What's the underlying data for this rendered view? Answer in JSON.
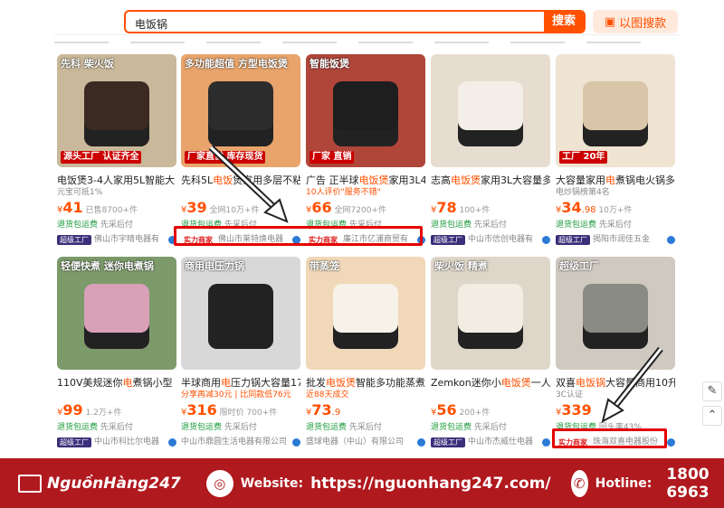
{
  "search": {
    "query": "电饭锅",
    "button": "搜索",
    "image_search": "以图搜款"
  },
  "row1": [
    {
      "title_pre": "电饭煲3-4人家用5L智能大",
      "hl": "",
      "title_post": "",
      "sub": "元宝可抵1%",
      "sub_red": false,
      "price": "41",
      "price_suffix": "",
      "sold": "已售8700+件",
      "ship": "退货包运费",
      "ship2": "先采后付",
      "badge": "超级工厂",
      "shop": "佛山市宇晴电器有",
      "ov": "先科 柴火饭",
      "ov2": "源头工厂 认证齐全",
      "bg": "#c9b89a",
      "pr": "#3a2a22"
    },
    {
      "title_pre": "先科5L",
      "hl": "电饭",
      "title_post": "煲家用多层不粘球釜",
      "sub": "",
      "sub_red": false,
      "price": "39",
      "price_suffix": "",
      "sold": "全网10万+件",
      "ship": "退货包运费",
      "ship2": "先采后付",
      "badge": "实力商家",
      "shop": "佛山市莱特焕电器",
      "ov": "多功能超值 方型电饭煲",
      "ov2": "厂家直供 库存现货",
      "bg": "#e8a46a",
      "pr": "#2c2c2c"
    },
    {
      "title_pre": "广告 正半球",
      "hl": "电饭煲",
      "title_post": "家用3L4L",
      "sub": "10人评价\"服务不错\"",
      "sub_red": true,
      "price": "66",
      "price_suffix": "",
      "sold": "全网7200+件",
      "ship": "退货包运费",
      "ship2": "先采后付",
      "badge": "实力商家",
      "shop": "廉江市亿浦商贸有",
      "ov": "智能饭煲",
      "ov2": "厂家 直销",
      "bg": "#b0463a",
      "pr": "#1e1e1e"
    },
    {
      "title_pre": "志高",
      "hl": "电饭煲",
      "title_post": "家用3L大容量多",
      "sub": "",
      "sub_red": false,
      "price": "78",
      "price_suffix": "",
      "sold": "100+件",
      "ship": "退货包运费",
      "ship2": "先采后付",
      "badge": "超级工厂",
      "shop": "中山市信创电器有",
      "ov": "",
      "ov2": "",
      "bg": "#e6ddd0",
      "pr": "#f3efe8"
    },
    {
      "title_pre": "大容量家用",
      "hl": "电",
      "title_post": "煮锅电火锅多",
      "sub": "电炒锅榜第4名",
      "sub_red": false,
      "price": "34",
      "price_suffix": ".98",
      "sold": "10万+件",
      "ship": "退货包运费",
      "ship2": "先采后付",
      "badge": "超级工厂",
      "shop": "揭阳市润佳五金",
      "ov": "",
      "ov2": "工厂 20年",
      "bg": "#efe3d2",
      "pr": "#d9c6a8"
    }
  ],
  "row2": [
    {
      "title_pre": "110V美规迷你",
      "hl": "电",
      "title_post": "煮锅小型",
      "sub": "",
      "sub_red": false,
      "price": "99",
      "price_suffix": "",
      "sold": "1.2万+件",
      "ship": "退货包运费",
      "ship2": "先采后付",
      "badge": "超级工厂",
      "shop": "中山市科比尔电器",
      "ov": "轻便快煮 迷你电煮锅",
      "ov2": "",
      "bg": "#7c9a6a",
      "pr": "#d9a0b8"
    },
    {
      "title_pre": "半球商用",
      "hl": "电",
      "title_post": "压力锅大容量17",
      "sub": "分享再减30元 | 比同款低76元",
      "sub_red": true,
      "price": "316",
      "price_suffix": "",
      "sold": "限时价 700+件",
      "ship": "退货包运费",
      "ship2": "先采后付",
      "badge": "",
      "shop": "中山市鼎圆生活电器有限公司",
      "ov": "商用电压力锅",
      "ov2": "",
      "bg": "#d8d8d8",
      "pr": "#222222"
    },
    {
      "title_pre": "批发",
      "hl": "电饭煲",
      "title_post": "智能多功能蒸煮",
      "sub": "近88天成交",
      "sub_red": true,
      "price": "73",
      "price_suffix": ".9",
      "sold": "",
      "ship": "退货包运费",
      "ship2": "先采后付",
      "badge": "",
      "shop": "盛球电器（中山）有限公司",
      "ov": "带蒸笼",
      "ov2": "",
      "bg": "#f1d8b8",
      "pr": "#f6f2ea"
    },
    {
      "title_pre": "Zemkon迷你小",
      "hl": "电饭煲",
      "title_post": "一人",
      "sub": "",
      "sub_red": false,
      "price": "56",
      "price_suffix": "",
      "sold": "200+件",
      "ship": "退货包运费",
      "ship2": "先采后付",
      "badge": "超级工厂",
      "shop": "中山市杰威仕电器",
      "ov": "柴火饭 精煮",
      "ov2": "",
      "bg": "#ded6c8",
      "pr": "#f2ede2"
    },
    {
      "title_pre": "双喜",
      "hl": "电饭锅",
      "title_post": "大容量商用10升",
      "sub": "3C认证",
      "sub_red": false,
      "price": "339",
      "price_suffix": "",
      "sold": "",
      "ship": "退货包运费",
      "ship2": "回头率43%",
      "badge": "实力商家",
      "shop": "珠海双喜电器股份",
      "ov": "超级工厂",
      "ov2": "",
      "bg": "#cfc9bf",
      "pr": "#8a8a84"
    }
  ],
  "footer": {
    "brand": "NguồnHàng247",
    "website_label": "Website:",
    "website": "https://nguonhang247.com/",
    "hotline_label": "Hotline:",
    "hotline": "1800 6963"
  },
  "colors": {
    "accent": "#ff5000",
    "footer": "#b0191e",
    "highlight": "#e30000"
  }
}
